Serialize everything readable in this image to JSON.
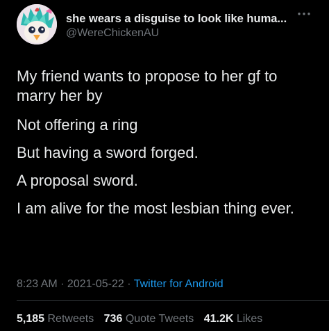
{
  "author": {
    "display_name": "she wears a disguise to look like huma...",
    "handle": "@WereChickenAU"
  },
  "more_icon": "more-horizontal-icon",
  "text_lines": [
    "My friend wants to propose to her gf to marry her by",
    "Not offering a ring",
    "But having a sword forged.",
    "A proposal sword.",
    "I am alive for the most lesbian thing ever."
  ],
  "meta": {
    "time": "8:23 AM",
    "sep1": " · ",
    "date": "2021-05-22",
    "sep2": " · ",
    "source": "Twitter for Android"
  },
  "stats": {
    "retweets": {
      "count": "5,185",
      "label": "Retweets"
    },
    "quotes": {
      "count": "736",
      "label": "Quote Tweets"
    },
    "likes": {
      "count": "41.2K",
      "label": "Likes"
    }
  },
  "colors": {
    "background": "#000000",
    "text": "#e7e9ea",
    "secondary": "#71767b",
    "link": "#1d9bf0"
  }
}
